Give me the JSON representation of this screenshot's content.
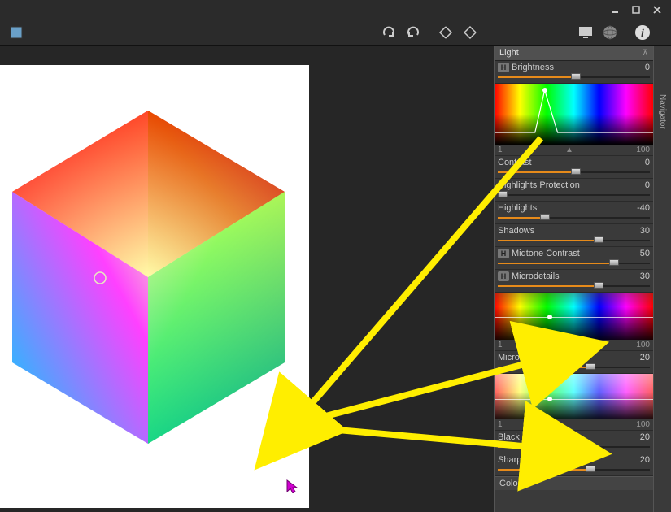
{
  "window": {
    "minimize": "−",
    "maximize": "❐",
    "close": "✕"
  },
  "sidebar": {
    "navigator": "Navigator"
  },
  "panel": {
    "title": "Light",
    "pin": "📌",
    "range_low": "1",
    "range_high": "100",
    "controls": {
      "brightness": {
        "label": "Brightness",
        "value": "0",
        "badge": "H"
      },
      "contrast": {
        "label": "Contrast",
        "value": "0"
      },
      "highlights_protection": {
        "label": "Highlights Protection",
        "value": "0"
      },
      "highlights": {
        "label": "Highlights",
        "value": "-40"
      },
      "shadows": {
        "label": "Shadows",
        "value": "30"
      },
      "midtone_contrast": {
        "label": "Midtone Contrast",
        "value": "50",
        "badge": "H"
      },
      "microdetails": {
        "label": "Microdetails",
        "value": "30",
        "badge": "H"
      },
      "microcontrast": {
        "label": "Microcontrast",
        "value": "20"
      },
      "black": {
        "label": "Black",
        "value": "20"
      },
      "sharpening": {
        "label": "Sharpening",
        "value": "20"
      }
    },
    "color_section": "Color"
  }
}
